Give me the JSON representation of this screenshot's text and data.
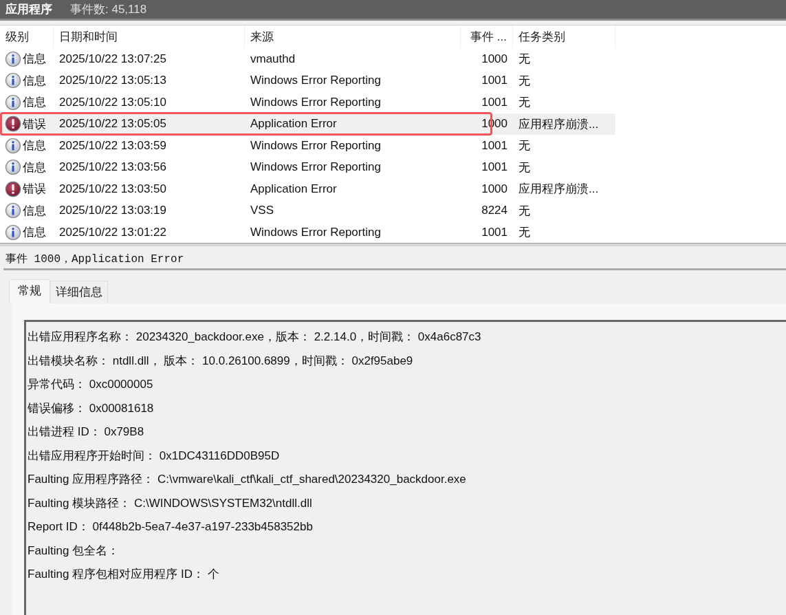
{
  "header": {
    "title": "应用程序",
    "event_count": "事件数: 45,118"
  },
  "table": {
    "columns": [
      "级别",
      "日期和时间",
      "来源",
      "事件 ...",
      "任务类别"
    ],
    "rows": [
      {
        "kind": "info",
        "level": "信息",
        "date": "2025/10/22 13:07:25",
        "source": "vmauthd",
        "event_id": "1000",
        "task": "无",
        "selected": false,
        "annotated": false
      },
      {
        "kind": "info",
        "level": "信息",
        "date": "2025/10/22 13:05:13",
        "source": "Windows Error Reporting",
        "event_id": "1001",
        "task": "无",
        "selected": false,
        "annotated": false
      },
      {
        "kind": "info",
        "level": "信息",
        "date": "2025/10/22 13:05:10",
        "source": "Windows Error Reporting",
        "event_id": "1001",
        "task": "无",
        "selected": false,
        "annotated": false
      },
      {
        "kind": "error",
        "level": "错误",
        "date": "2025/10/22 13:05:05",
        "source": "Application Error",
        "event_id": "1000",
        "task": "应用程序崩溃...",
        "selected": true,
        "annotated": true
      },
      {
        "kind": "info",
        "level": "信息",
        "date": "2025/10/22 13:03:59",
        "source": "Windows Error Reporting",
        "event_id": "1001",
        "task": "无",
        "selected": false,
        "annotated": false
      },
      {
        "kind": "info",
        "level": "信息",
        "date": "2025/10/22 13:03:56",
        "source": "Windows Error Reporting",
        "event_id": "1001",
        "task": "无",
        "selected": false,
        "annotated": false
      },
      {
        "kind": "error",
        "level": "错误",
        "date": "2025/10/22 13:03:50",
        "source": "Application Error",
        "event_id": "1000",
        "task": "应用程序崩溃...",
        "selected": false,
        "annotated": false
      },
      {
        "kind": "info",
        "level": "信息",
        "date": "2025/10/22 13:03:19",
        "source": "VSS",
        "event_id": "8224",
        "task": "无",
        "selected": false,
        "annotated": false
      },
      {
        "kind": "info",
        "level": "信息",
        "date": "2025/10/22 13:01:22",
        "source": "Windows Error Reporting",
        "event_id": "1001",
        "task": "无",
        "selected": false,
        "annotated": false
      }
    ]
  },
  "details": {
    "title": "事件 1000，Application Error",
    "tabs": [
      {
        "label": "常规",
        "selected": true
      },
      {
        "label": "详细信息",
        "selected": false
      }
    ],
    "lines": [
      "出错应用程序名称： 20234320_backdoor.exe，版本： 2.2.14.0，时间戳： 0x4a6c87c3",
      "出错模块名称： ntdll.dll， 版本： 10.0.26100.6899，时间戳： 0x2f95abe9",
      "异常代码： 0xc0000005",
      "错误偏移： 0x00081618",
      "出错进程 ID： 0x79B8",
      "出错应用程序开始时间： 0x1DC43116DD0B95D",
      "Faulting 应用程序路径： C:\\vmware\\kali_ctf\\kali_ctf_shared\\20234320_backdoor.exe",
      "Faulting 模块路径： C:\\WINDOWS\\SYSTEM32\\ntdll.dll",
      "Report ID： 0f448b2b-5ea7-4e37-a197-233b458352bb",
      "Faulting 包全名：",
      "Faulting 程序包相对应用程序 ID：  个"
    ]
  }
}
